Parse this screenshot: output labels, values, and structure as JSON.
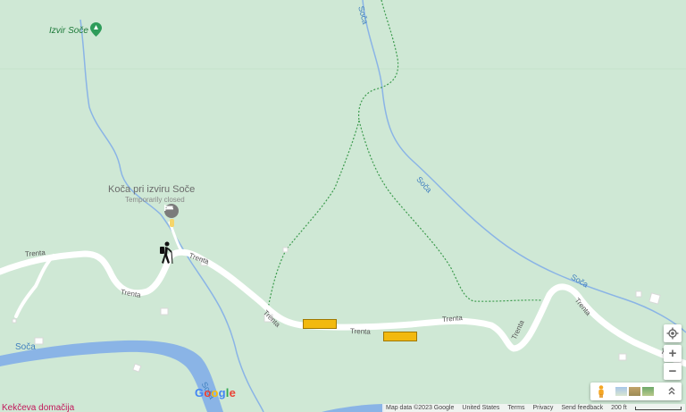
{
  "labels": {
    "poi_title": "Koča pri izviru Soče",
    "poi_status": "Temporarily closed",
    "source_place": "Izvir Soče",
    "bottom_place": "Kekčeva domačija"
  },
  "roads": [
    {
      "text": "Trenta"
    },
    {
      "text": "Trenta"
    },
    {
      "text": "Trenta"
    },
    {
      "text": "Trenta"
    },
    {
      "text": "Trenta"
    },
    {
      "text": "Trenta"
    },
    {
      "text": "Trenta"
    },
    {
      "text": "Trenta"
    },
    {
      "text": "Trenta"
    }
  ],
  "rivers": [
    {
      "text": "Soča"
    },
    {
      "text": "Soča"
    },
    {
      "text": "Soča"
    },
    {
      "text": "Soča"
    },
    {
      "text": "Soča"
    }
  ],
  "controls": {
    "zoom_in": "+",
    "zoom_out": "−"
  },
  "logo": {
    "letters": [
      "G",
      "o",
      "o",
      "g",
      "l",
      "e"
    ],
    "colors": [
      "#4285F4",
      "#EA4335",
      "#FBBC05",
      "#4285F4",
      "#34A853",
      "#EA4335"
    ]
  },
  "attribution": {
    "map_data": "Map data ©2023 Google",
    "region": "United States",
    "terms": "Terms",
    "privacy": "Privacy",
    "feedback": "Send feedback",
    "scale": "200 ft"
  },
  "colors": {
    "land": "#cfe8d5",
    "river": "#8ab4e6",
    "road": "#ffffff",
    "trail": "#3d9b4e",
    "marker": "#f2b90f"
  },
  "icons": {
    "hotel": "hotel-icon",
    "hiker": "hiker-icon",
    "place_pin": "place-pin-icon",
    "location": "my-location-icon",
    "pegman": "pegman-icon"
  }
}
